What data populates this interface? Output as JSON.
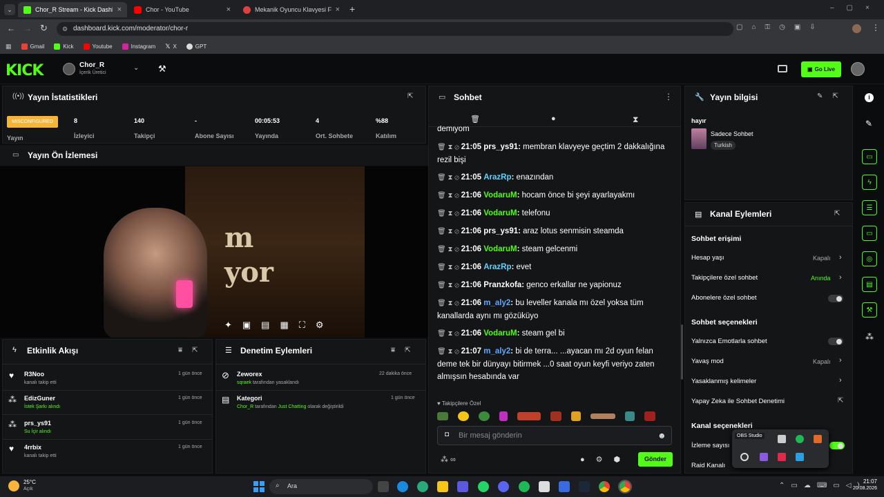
{
  "browser": {
    "tabs": [
      {
        "label": "Chor_R Stream - Kick Dashboard",
        "color": "#53fc18"
      },
      {
        "label": "Chor - YouTube",
        "color": "#ff0000"
      },
      {
        "label": "Mekanik Oyuncu Klavyesi Fiyatl",
        "color": "#e04040"
      }
    ],
    "url": "dashboard.kick.com/moderator/chor-r",
    "bookmarks": [
      "Gmail",
      "Kick",
      "Youtube",
      "Instagram",
      "X",
      "GPT"
    ]
  },
  "header": {
    "logo": "KICK",
    "channel_name": "Chor_R",
    "channel_role": "İçerik Üretici",
    "go_live": "Go Live"
  },
  "stats": {
    "title": "Yayın İstatistikleri",
    "badge": "MISCONFIGURED",
    "badge_label": "Yayın",
    "items": [
      {
        "value": "8",
        "label": "İzleyici"
      },
      {
        "value": "140",
        "label": "Takipçi"
      },
      {
        "value": "-",
        "label": "Abone Sayısı"
      },
      {
        "value": "00:05:53",
        "label": "Yayında"
      },
      {
        "value": "4",
        "label": "Ort. Sohbete"
      },
      {
        "value": "%88",
        "label": "Katılım"
      }
    ]
  },
  "preview": {
    "title": "Yayın Ön İzlemesi",
    "overlay_text_1": "m",
    "overlay_text_2": "yor"
  },
  "activity": {
    "title": "Etkinlik Akışı",
    "items": [
      {
        "name": "R3Noo",
        "sub": "kanalı takip etti",
        "time": "1 gün önce",
        "icon": "heart-icon"
      },
      {
        "name": "EdizGuner",
        "sub": "İstek Şarkı alındı",
        "time": "1 gün önce",
        "icon": "gift-icon"
      },
      {
        "name": "prs_ys91",
        "sub": "Su İçir alındı",
        "time": "1 gün önce",
        "icon": "gift-icon"
      },
      {
        "name": "4rrbix",
        "sub": "kanalı takip etti",
        "time": "1 gün önce",
        "icon": "heart-icon"
      }
    ]
  },
  "moderation": {
    "title": "Denetim Eylemleri",
    "items": [
      {
        "name": "Zeworex",
        "actor": "sqraek",
        "action": "tarafından yasaklandı",
        "time": "22 dakika önce"
      },
      {
        "name": "Kategori",
        "actor": "Chor_R",
        "action": "tarafından",
        "target": "Just Chatting",
        "action2": "olarak değiştirildi",
        "time": "1 gün önce"
      }
    ]
  },
  "chat": {
    "title": "Sohbet",
    "partial_top": "demiyom",
    "messages": [
      {
        "time": "21:05",
        "user": "prs_ys91",
        "color": "#ffffff",
        "text": "membran klavyeye geçtim 2 dakkalığına rezil bişi"
      },
      {
        "time": "21:05",
        "user": "ArazRp",
        "color": "#5fd3ff",
        "text": "enazından"
      },
      {
        "time": "21:06",
        "user": "VodaruM",
        "color": "#53fc18",
        "text": "hocam önce bi şeyi ayarlayakmı"
      },
      {
        "time": "21:06",
        "user": "VodaruM",
        "color": "#53fc18",
        "text": "telefonu"
      },
      {
        "time": "21:06",
        "user": "prs_ys91",
        "color": "#ffffff",
        "text": "araz lotus senmisin steamda"
      },
      {
        "time": "21:06",
        "user": "VodaruM",
        "color": "#53fc18",
        "text": "steam gelcenmi"
      },
      {
        "time": "21:06",
        "user": "ArazRp",
        "color": "#5fd3ff",
        "text": "evet"
      },
      {
        "time": "21:06",
        "user": "Pranzkofa",
        "color": "#ffffff",
        "text": "genco erkallar ne yapionuz"
      },
      {
        "time": "21:06",
        "user": "m_aly2",
        "color": "#5fa8ff",
        "text": "bu leveller kanala mı özel yoksa tüm kanallarda aynı mı gözüküyo"
      },
      {
        "time": "21:06",
        "user": "VodaruM",
        "color": "#53fc18",
        "text": "steam gel bi"
      },
      {
        "time": "21:07",
        "user": "m_aly2",
        "color": "#5fa8ff",
        "text": "bi de terra... ...ayacan mı 2d oyun felan deme tek bir dünyayı bitirmek ...0 saat oyun keyfi veriyo zaten almışsın hesabında var"
      }
    ],
    "followers_only": "Takipçilere Özel",
    "placeholder": "Bir mesaj gönderin",
    "send": "Gönder"
  },
  "stream_info": {
    "title": "Yayın bilgisi",
    "stream_title": "hayır",
    "category": "Sadece Sohbet",
    "tag": "Turkish"
  },
  "channel_actions": {
    "title": "Kanal Eylemleri",
    "chat_access": "Sohbet erişimi",
    "account_age": {
      "label": "Hesap yaşı",
      "value": "Kapalı"
    },
    "followers_chat": {
      "label": "Takipçilere özel sohbet",
      "value": "Anında"
    },
    "subs_chat": {
      "label": "Abonelere özel sohbet"
    },
    "chat_options": "Sohbet seçenekleri",
    "emotes_only": {
      "label": "Yalnızca Emotlarla sohbet"
    },
    "slow_mode": {
      "label": "Yavaş mod",
      "value": "Kapalı"
    },
    "banned_words": {
      "label": "Yasaklanmış kelimeler"
    },
    "ai_moderation": {
      "label": "Yapay Zeka ile Sohbet Denetimi"
    },
    "channel_options": "Kanal seçenekleri",
    "viewer_count": {
      "label": "İzleme sayısı"
    },
    "raid": {
      "label": "Raid Kanalı"
    },
    "obs_tooltip": "OBS Studio"
  },
  "taskbar": {
    "weather_temp": "25°C",
    "weather_desc": "Açık",
    "search": "Ara",
    "clock_time": "21:07",
    "clock_date": "20.08.2026"
  },
  "colors": {
    "accent": "#53fc18",
    "panel": "#141517",
    "bg": "#0b0c0e"
  }
}
